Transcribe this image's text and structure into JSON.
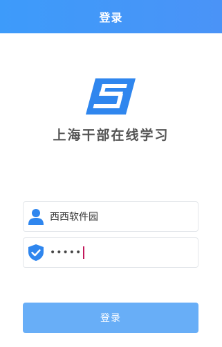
{
  "header": {
    "title": "登录"
  },
  "app": {
    "logo_icon": "stylized-s-logo-icon",
    "name": "上海干部在线学习"
  },
  "form": {
    "username": {
      "icon": "user-icon",
      "value": "西西软件园"
    },
    "password": {
      "icon": "shield-check-icon",
      "masked_value": "•••••"
    },
    "submit_label": "登录"
  },
  "colors": {
    "header_gradient_start": "#3d9bfa",
    "header_gradient_end": "#4a93f7",
    "accent_blue": "#2f86ee",
    "button_bg": "#68aef7",
    "caret": "#c2185b"
  }
}
